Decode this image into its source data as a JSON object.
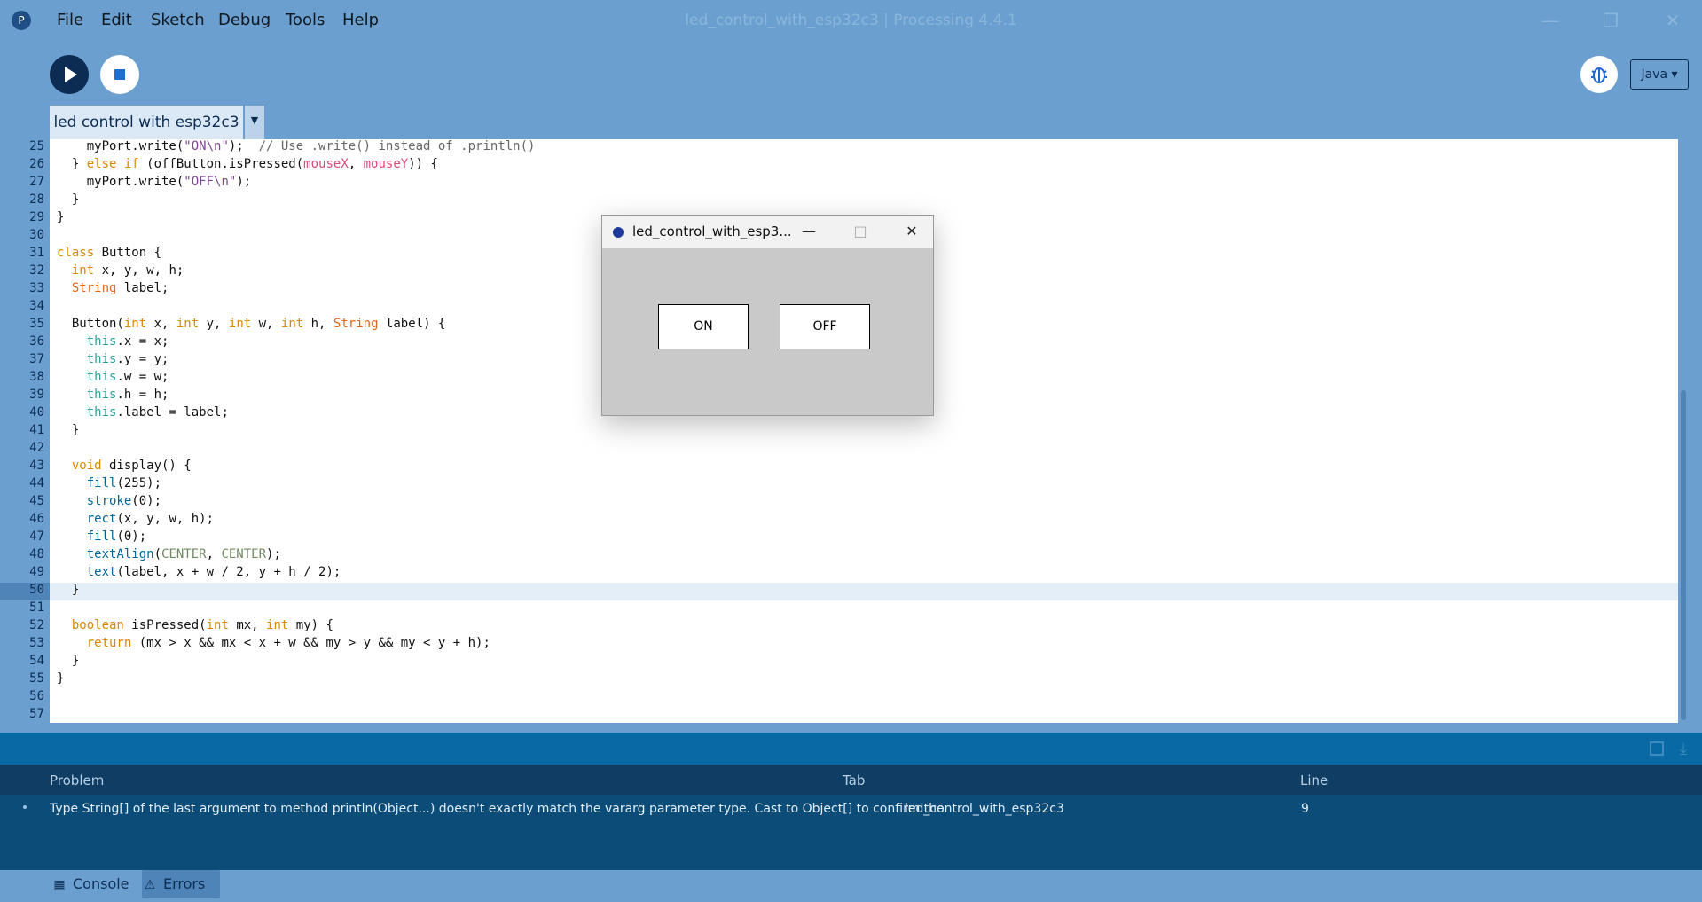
{
  "window": {
    "title": "led_control_with_esp32c3 | Processing 4.4.1"
  },
  "menu": [
    "File",
    "Edit",
    "Sketch",
    "Debug",
    "Tools",
    "Help"
  ],
  "toolbar": {
    "mode": "Java ▾"
  },
  "tab": {
    "label": "led control with esp32c3"
  },
  "editor": {
    "line_numbers": [
      "25",
      "26",
      "27",
      "28",
      "29",
      "30",
      "31",
      "32",
      "33",
      "34",
      "35",
      "36",
      "37",
      "38",
      "39",
      "40",
      "41",
      "42",
      "43",
      "44",
      "45",
      "46",
      "47",
      "48",
      "49",
      "50",
      "51",
      "52",
      "53",
      "54",
      "55",
      "56",
      "57"
    ],
    "current_line": "50"
  },
  "problems": {
    "headers": {
      "problem": "Problem",
      "tab": "Tab",
      "line": "Line"
    },
    "rows": [
      {
        "message": "Type String[] of the last argument to method println(Object...) doesn't exactly match the vararg parameter type. Cast to Object[] to confirm the",
        "tab": "led_control_with_esp32c3",
        "line": "9"
      }
    ]
  },
  "bottom_tabs": {
    "console": "Console",
    "errors": "Errors"
  },
  "sketch_window": {
    "title": "led_control_with_esp3...",
    "on_label": "ON",
    "off_label": "OFF"
  }
}
